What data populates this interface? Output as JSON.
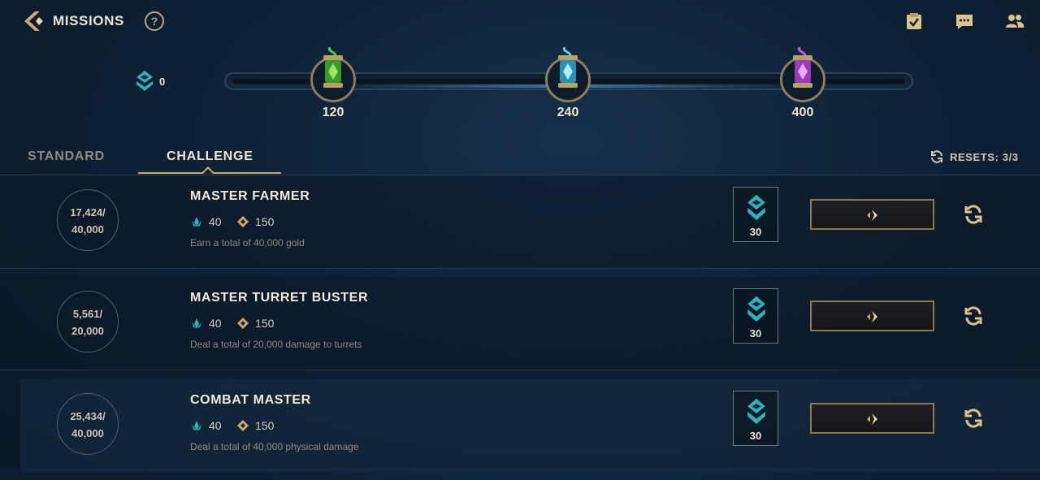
{
  "header": {
    "title": "MISSIONS",
    "help_label": "?",
    "icons": [
      "back-icon",
      "help-icon",
      "checklist-icon",
      "chat-icon",
      "friends-icon"
    ]
  },
  "progress": {
    "token_count": "0",
    "milestones": [
      {
        "label": "120",
        "color": "#5fbf3a"
      },
      {
        "label": "240",
        "color": "#5ad0e8"
      },
      {
        "label": "400",
        "color": "#c85ae0"
      }
    ]
  },
  "tabs": {
    "standard": "STANDARD",
    "challenge": "CHALLENGE",
    "active": "challenge"
  },
  "resets": {
    "label": "RESETS: 3/3"
  },
  "missions": [
    {
      "progress_current": "17,424/",
      "progress_total": "40,000",
      "name": "MASTER FARMER",
      "token_reward": "40",
      "rank_reward": "150",
      "description": "Earn a total of 40,000 gold",
      "box_reward": "30"
    },
    {
      "progress_current": "5,561/",
      "progress_total": "20,000",
      "name": "MASTER TURRET BUSTER",
      "token_reward": "40",
      "rank_reward": "150",
      "description": "Deal a total of 20,000 damage to turrets",
      "box_reward": "30"
    },
    {
      "progress_current": "25,434/",
      "progress_total": "40,000",
      "name": "COMBAT MASTER",
      "token_reward": "40",
      "rank_reward": "150",
      "description": "Deal a total of 40,000 physical damage",
      "box_reward": "30"
    }
  ],
  "colors": {
    "gold": "#c8aa6e",
    "teal": "#2bb3b8",
    "text": "#f0eadb"
  }
}
